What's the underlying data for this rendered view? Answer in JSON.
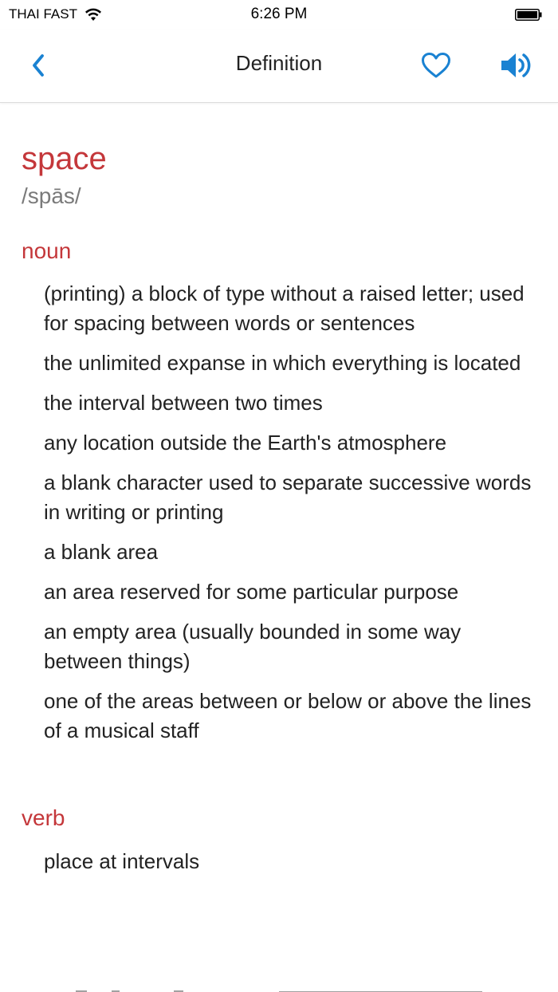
{
  "status_bar": {
    "carrier": "THAI FAST",
    "time": "6:26 PM",
    "icons": [
      "wifi-icon",
      "battery-icon"
    ]
  },
  "nav_bar": {
    "title": "Definition",
    "icons": [
      "chevron-left-icon",
      "heart-icon",
      "speaker-icon"
    ],
    "accent_color": "#1a82d2"
  },
  "entry": {
    "word": "space",
    "pronunciation": "/spās/",
    "word_color": "#c4373a",
    "senses": [
      {
        "part_of_speech": "noun",
        "definitions": [
          "(printing) a block of type without a raised letter; used for spacing between words or sentences",
          "the unlimited expanse in which everything is located",
          "the interval between two times",
          "any location outside the Earth's atmosphere",
          "a blank character used to separate successive words in writing or printing",
          "a blank area",
          "an area reserved for some particular purpose",
          "an empty area (usually bounded in some way between things)",
          "one of the areas between or below or above the lines of a musical staff"
        ]
      },
      {
        "part_of_speech": "verb",
        "definitions": [
          "place at intervals"
        ]
      }
    ]
  }
}
